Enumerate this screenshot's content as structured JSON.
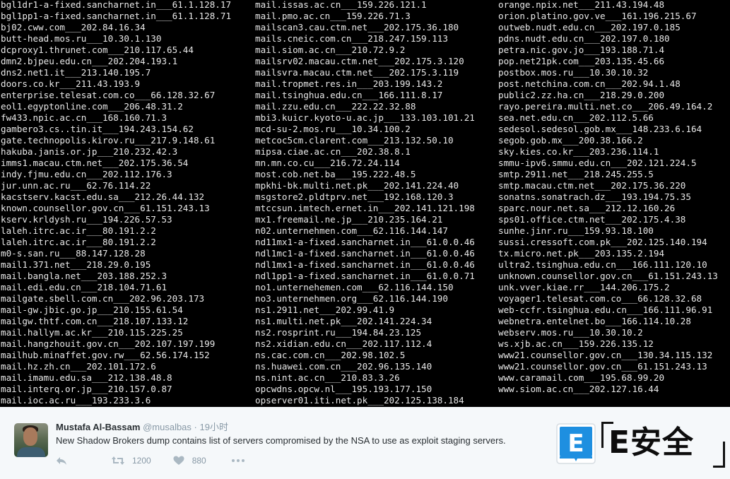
{
  "terminal": {
    "columns": [
      [
        "bgl1dr1-a-fixed.sancharnet.in___61.1.128.17",
        "bgl1pp1-a-fixed.sancharnet.in___61.1.128.71",
        "bj02.cww.com___202.84.16.34",
        "butt-head.mos.ru___10.30.1.130",
        "dcproxy1.thrunet.com___210.117.65.44",
        "dmn2.bjpeu.edu.cn___202.204.193.1",
        "dns2.net1.it___213.140.195.7",
        "doors.co.kr___211.43.193.9",
        "enterprise.telesat.com.co___66.128.32.67",
        "eol1.egyptonline.com___206.48.31.2",
        "fw433.npic.ac.cn___168.160.71.3",
        "gambero3.cs..tin.it___194.243.154.62",
        "gate.technopolis.kirov.ru___217.9.148.61",
        "hakuba.janis.or.jp___210.232.42.3",
        "imms1.macau.ctm.net___202.175.36.54",
        "indy.fjmu.edu.cn___202.112.176.3",
        "jur.unn.ac.ru___62.76.114.22",
        "kacstserv.kacst.edu.sa___212.26.44.132",
        "known.counsellor.gov.cn___61.151.243.13",
        "kserv.krldysh.ru___194.226.57.53",
        "laleh.itrc.ac.ir___80.191.2.2",
        "laleh.itrc.ac.ir___80.191.2.2",
        "m0-s.san.ru___88.147.128.28",
        "mail1.371.net___218.29.0.195",
        "mail.bangla.net___203.188.252.3",
        "mail.edi.edu.cn___218.104.71.61",
        "mailgate.sbell.com.cn___202.96.203.173",
        "mail-gw.jbic.go.jp___210.155.61.54",
        "mailgw.thtf.com.cn___218.107.133.12",
        "mail.hallym.ac.kr___210.115.225.25",
        "mail.hangzhouit.gov.cn___202.107.197.199",
        "mailhub.minaffet.gov.rw___62.56.174.152",
        "mail.hz.zh.cn___202.101.172.6",
        "mail.imamu.edu.sa___212.138.48.8",
        "mail.interq.or.jp___210.157.0.87",
        "mail.ioc.ac.ru___193.233.3.6"
      ],
      [
        "mail.issas.ac.cn___159.226.121.1",
        "mail.pmo.ac.cn___159.226.71.3",
        "mailscan3.cau.ctm.net___202.175.36.180",
        "mails.cneic.com.cn___218.247.159.113",
        "mail.siom.ac.cn___210.72.9.2",
        "mailsrv02.macau.ctm.net___202.175.3.120",
        "mailsvra.macau.ctm.net___202.175.3.119",
        "mail.tropmet.res.in___203.199.143.2",
        "mail.tsinghua.edu.cn___166.111.8.17",
        "mail.zzu.edu.cn___222.22.32.88",
        "mbi3.kuicr.kyoto-u.ac.jp___133.103.101.21",
        "mcd-su-2.mos.ru___10.34.100.2",
        "metcoc5cm.clarent.com___213.132.50.10",
        "mipsa.ciae.ac.cn___202.38.8.1",
        "mn.mn.co.cu___216.72.24.114",
        "most.cob.net.ba___195.222.48.5",
        "mpkhi-bk.multi.net.pk___202.141.224.40",
        "msgstore2.pldtprv.net___192.168.120.3",
        "mtccsun.imtech.ernet.in___202.141.121.198",
        "mx1.freemail.ne.jp___210.235.164.21",
        "n02.unternehmen.com___62.116.144.147",
        "nd11mx1-a-fixed.sancharnet.in___61.0.0.46",
        "ndl1mc1-a-fixed.sancharnet.in___61.0.0.46",
        "ndl1mx1-a-fixed.sancharnet.in___61.0.0.46",
        "ndl1pp1-a-fixed.sancharnet.in___61.0.0.71",
        "no1.unternehemen.com___62.116.144.150",
        "no3.unternehmen.org___62.116.144.190",
        "ns1.2911.net___202.99.41.9",
        "ns1.multi.net.pk___202.141.224.34",
        "ns2.rosprint.ru___194.84.23.125",
        "ns2.xidian.edu.cn___202.117.112.4",
        "ns.cac.com.cn___202.98.102.5",
        "ns.huawei.com.cn___202.96.135.140",
        "ns.nint.ac.cn___210.83.3.26",
        "opcwdns.opcw.nl___195.193.177.150",
        "opserver01.iti.net.pk___202.125.138.184"
      ],
      [
        "orange.npix.net___211.43.194.48",
        "orion.platino.gov.ve___161.196.215.67",
        "outweb.nudt.edu.cn___202.197.0.185",
        "pdns.nudt.edu.cn___202.197.0.180",
        "petra.nic.gov.jo___193.188.71.4",
        "pop.net21pk.com___203.135.45.66",
        "postbox.mos.ru___10.30.10.32",
        "post.netchina.com.cn___202.94.1.48",
        "public2.zz.ha.cn___218.29.0.200",
        "rayo.pereira.multi.net.co___206.49.164.2",
        "sea.net.edu.cn___202.112.5.66",
        "sedesol.sedesol.gob.mx___148.233.6.164",
        "segob.gob.mx___200.38.166.2",
        "sky.kies.co.kr___203.236.114.1",
        "smmu-ipv6.smmu.edu.cn___202.121.224.5",
        "smtp.2911.net___218.245.255.5",
        "smtp.macau.ctm.net___202.175.36.220",
        "sonatns.sonatrach.dz___193.194.75.35",
        "sparc.nour.net.sa___212.12.160.26",
        "sps01.office.ctm.net___202.175.4.38",
        "sunhe.jinr.ru___159.93.18.100",
        "sussi.cressoft.com.pk___202.125.140.194",
        "tx.micro.net.pk___203.135.2.194",
        "ultra2.tsinghua.edu.cn___166.111.120.10",
        "unknown.counsellor.gov.cn___61.151.243.13",
        "unk.vver.kiae.rr___144.206.175.2",
        "voyager1.telesat.com.co___66.128.32.68",
        "web-ccfr.tsinghua.edu.cn___166.111.96.91",
        "webnetra.entelnet.bo___166.114.10.28",
        "webserv.mos.ru___10.30.10.2",
        "ws.xjb.ac.cn___159.226.135.12",
        "www21.counsellor.gov.cn___130.34.115.132",
        "www21.counsellor.gov.cn___61.151.243.13",
        "www.caramail.com___195.68.99.20",
        "www.siom.ac.cn___202.127.16.44"
      ]
    ]
  },
  "tweet": {
    "author_name": "Mustafa Al-Bassam",
    "author_handle": "@musalbas",
    "separator": "·",
    "timestamp": "19小时",
    "text": "New Shadow Brokers dump contains list of servers compromised by the NSA to use as exploit staging servers.",
    "retweet_count": "1200",
    "like_count": "880",
    "icons": [
      "reply-icon",
      "retweet-icon",
      "heart-icon",
      "more-icon"
    ],
    "colors": {
      "muted": "#8899a6",
      "text": "#292f33",
      "background": "#f5f8fa"
    }
  },
  "watermark": {
    "tile_letter": "E",
    "text": "E安全",
    "colors": {
      "tile": "#1e8fe0",
      "text": "#0d0d0d"
    }
  }
}
